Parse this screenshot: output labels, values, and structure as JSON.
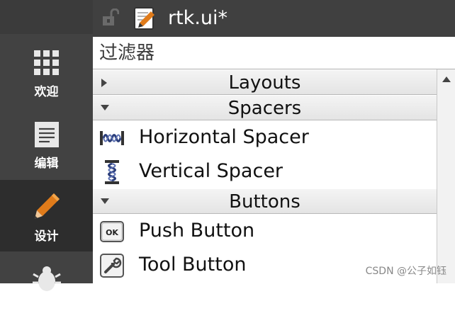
{
  "document": {
    "title": "rtk.ui*"
  },
  "modes": [
    {
      "label": "欢迎",
      "icon": "grid-icon"
    },
    {
      "label": "编辑",
      "icon": "document-lines-icon"
    },
    {
      "label": "设计",
      "icon": "pencil-icon"
    },
    {
      "label": "",
      "icon": "bug-icon"
    }
  ],
  "filter": {
    "placeholder": "过滤器",
    "value": ""
  },
  "widget_box": {
    "categories": [
      {
        "label": "Layouts",
        "expanded": false,
        "items": []
      },
      {
        "label": "Spacers",
        "expanded": true,
        "items": [
          {
            "label": "Horizontal Spacer",
            "icon": "horizontal-spacer-icon"
          },
          {
            "label": "Vertical Spacer",
            "icon": "vertical-spacer-icon"
          }
        ]
      },
      {
        "label": "Buttons",
        "expanded": true,
        "items": [
          {
            "label": "Push Button",
            "icon": "push-button-icon"
          },
          {
            "label": "Tool Button",
            "icon": "tool-button-icon"
          }
        ]
      }
    ]
  },
  "watermark": "CSDN @公子如钰",
  "colors": {
    "sidebar": "#424242",
    "sidebar_active": "#2d2d2d",
    "docbar": "#404040",
    "accent_pencil": "#e07b1a"
  }
}
